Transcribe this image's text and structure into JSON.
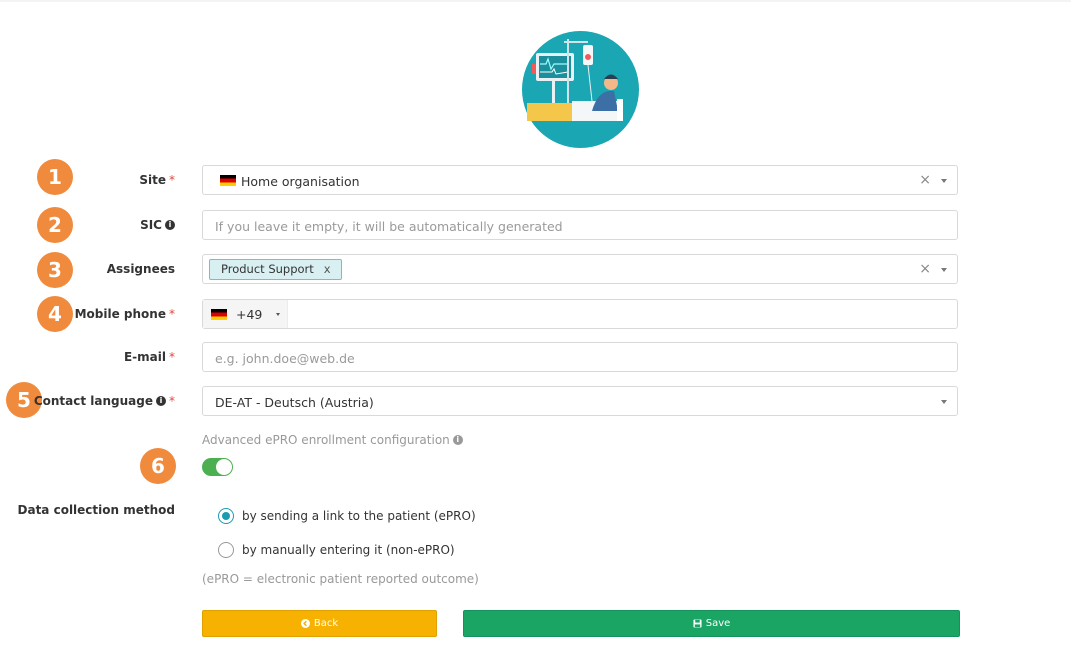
{
  "badges": [
    "1",
    "2",
    "3",
    "4",
    "5",
    "6"
  ],
  "form": {
    "site": {
      "label": "Site",
      "required": "*",
      "value": "Home organisation",
      "clear": "×"
    },
    "sic": {
      "label": "SIC",
      "info": "i",
      "placeholder": "If you leave it empty, it will be automatically generated"
    },
    "assignees": {
      "label": "Assignees",
      "tag": "Product Support",
      "tag_remove": "x",
      "clear": "×"
    },
    "mobile_phone": {
      "label": "Mobile phone",
      "required": "*",
      "country_code": "+49"
    },
    "email": {
      "label": "E-mail",
      "required": "*",
      "placeholder": "e.g. john.doe@web.de"
    },
    "contact_language": {
      "label": "Contact language",
      "info": "i",
      "required": "*",
      "value": "DE-AT - Deutsch (Austria)"
    },
    "advanced": {
      "label": "Advanced ePRO enrollment configuration",
      "info": "i",
      "enabled": true
    },
    "data_collection": {
      "label": "Data collection method",
      "options": [
        "by sending a link to the patient (ePRO)",
        "by manually entering it (non-ePRO)"
      ],
      "selected_index": 0,
      "note": "(ePRO = electronic patient reported outcome)"
    }
  },
  "buttons": {
    "back": "Back",
    "save": "Save"
  },
  "colors": {
    "back": "#f7b100",
    "save": "#1aa565",
    "badge": "#f08a3c",
    "toggle_on": "#4caf50",
    "radio_on": "#1a9bb0"
  }
}
